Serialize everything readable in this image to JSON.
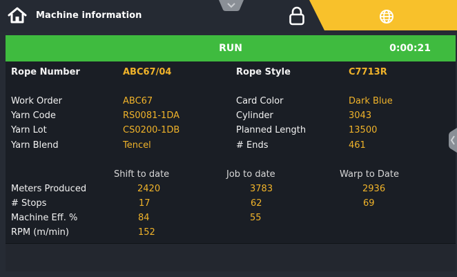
{
  "header": {
    "title": "Machine information"
  },
  "status_bar": {
    "state": "RUN",
    "elapsed": "0:00:21",
    "color": "#3fbb3f"
  },
  "rope": {
    "number_label": "Rope Number",
    "number_value": "ABC67/04",
    "style_label": "Rope Style",
    "style_value": "C7713R"
  },
  "left_fields": [
    {
      "label": "Work Order",
      "value": "ABC67"
    },
    {
      "label": "Yarn Code",
      "value": "RS0081-1DA"
    },
    {
      "label": "Yarn Lot",
      "value": "CS0200-1DB"
    },
    {
      "label": "Yarn Blend",
      "value": "Tencel"
    }
  ],
  "right_fields": [
    {
      "label": "Card Color",
      "value": "Dark Blue"
    },
    {
      "label": "Cylinder",
      "value": "3043"
    },
    {
      "label": "Planned Length",
      "value": "13500"
    },
    {
      "label": "# Ends",
      "value": "461"
    }
  ],
  "stats": {
    "columns": [
      "Shift to date",
      "Job to date",
      "Warp to Date"
    ],
    "rows": [
      {
        "label": "Meters Produced",
        "values": [
          "2420",
          "3783",
          "2936"
        ]
      },
      {
        "label": "# Stops",
        "values": [
          "17",
          "62",
          "69"
        ]
      },
      {
        "label": "Machine Eff. %",
        "values": [
          "84",
          "55",
          ""
        ]
      },
      {
        "label": "RPM (m/min)",
        "values": [
          "152",
          "",
          ""
        ]
      }
    ]
  },
  "colors": {
    "accent": "#f0b32a",
    "tab_yellow": "#f8c12b",
    "background": "#1a1e25"
  },
  "icons": [
    "home-icon",
    "chevron-down-icon",
    "lock-icon",
    "globe-icon",
    "chevron-left-icon"
  ]
}
